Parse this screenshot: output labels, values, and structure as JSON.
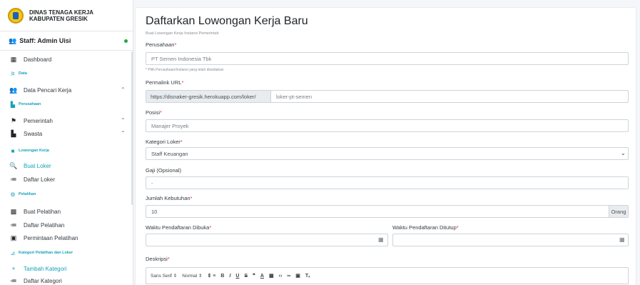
{
  "brand": {
    "line1": "DINAS TENAGA KERJA",
    "line2": "KABUPATEN GRESIK"
  },
  "user": {
    "name": "Staff: Admin Uisi"
  },
  "sidebar": {
    "dashboard": "Dashboard",
    "header_data": "Data",
    "data_pencari_kerja": "Data Pencari Kerja",
    "header_perusahaan": "Perusahaan",
    "pemerintah": "Pemerintah",
    "swasta": "Swasta",
    "header_lowongan": "Lowongan Kerja",
    "buat_loker": "Buat Loker",
    "daftar_loker": "Daftar Loker",
    "header_pelatihan": "Pelatihan",
    "buat_pelatihan": "Buat Pelatihan",
    "daftar_pelatihan": "Daftar Pelatihan",
    "permintaan_pelatihan": "Permintaan Pelatihan",
    "header_kategori": "Kategori Pelatihan dan Loker",
    "tambah_kategori": "Tambah Kategori",
    "daftar_kategori": "Daftar Kategori"
  },
  "page": {
    "title": "Daftarkan Lowongan Kerja Baru",
    "subtitle": "Buat Lowongan Kerja Instansi Pemerintah"
  },
  "form": {
    "perusahaan": {
      "label": "Perusahaan",
      "value": "PT Semen Indonesia Tbk",
      "hint": "* Pilih Perusahaan/Instansi yang telah disediakan"
    },
    "permalink": {
      "label": "Permalink URL",
      "prefix": "https://disnaker-gresik.herokuapp.com/loker/",
      "value": "loker-pt-semen"
    },
    "posisi": {
      "label": "Posisi",
      "value": "Manajer Proyek"
    },
    "kategori": {
      "label": "Kategori Loker",
      "value": "Staff Keuangan"
    },
    "gaji": {
      "label": "Gaji (Opsional)",
      "value": "-"
    },
    "jumlah": {
      "label": "Jumlah Kebutuhan",
      "value": "10",
      "suffix": "Orang"
    },
    "dibuka": {
      "label": "Waktu Pendaftaran Dibuka",
      "value": ""
    },
    "ditutup": {
      "label": "Waktu Pendaftaran Ditutup",
      "value": ""
    },
    "deskripsi": {
      "label": "Deskripsi"
    },
    "required_mark": "*"
  },
  "editor": {
    "font": "Sans Serif",
    "size": "Normal"
  }
}
